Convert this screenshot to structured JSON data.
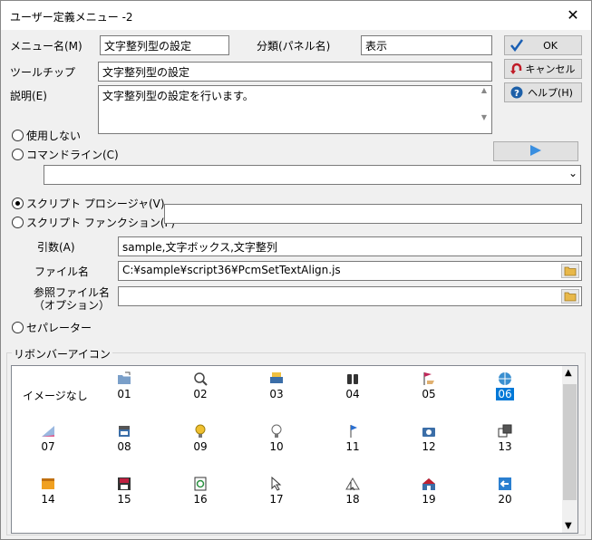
{
  "window": {
    "title": "ユーザー定義メニュー  -2",
    "close": "✕"
  },
  "form": {
    "menu_name_label": "メニュー名(M)",
    "menu_name_value": "文字整列型の設定",
    "category_label": "分類(パネル名)",
    "category_value": "表示",
    "tooltip_label": "ツールチップ",
    "tooltip_value": "文字整列型の設定",
    "description_label": "説明(E)",
    "description_value": "文字整列型の設定を行います。"
  },
  "buttons": {
    "ok": "OK",
    "cancel": "キャンセル",
    "help": "ヘルプ(H)"
  },
  "options": {
    "none": "使用しない",
    "command_line": "コマンドライン(C)",
    "script_procedure": "スクリプト プロシージャ(V)",
    "script_function": "スクリプト ファンクション(F)",
    "separator": "セパレーター",
    "selected": "script_procedure"
  },
  "script": {
    "args_label": "引数(A)",
    "args_value": "sample,文字ボックス,文字整列",
    "file_label": "ファイル名",
    "file_value": "C:¥sample¥script36¥PcmSetTextAlign.js",
    "ref_label_1": "参照ファイル名",
    "ref_label_2": "（オプション）",
    "ref_value": ""
  },
  "ribbon": {
    "group_label": "リボンバーアイコン",
    "no_image": "イメージなし",
    "icons": [
      {
        "num": "01",
        "icon": "folder-open-icon"
      },
      {
        "num": "02",
        "icon": "magnifier-icon"
      },
      {
        "num": "03",
        "icon": "printer-icon"
      },
      {
        "num": "04",
        "icon": "binoculars-icon"
      },
      {
        "num": "05",
        "icon": "flag-hand-icon"
      },
      {
        "num": "06",
        "icon": "globe-icon",
        "selected": true
      },
      {
        "num": "07",
        "icon": "gradient-icon"
      },
      {
        "num": "08",
        "icon": "printer-box-icon"
      },
      {
        "num": "09",
        "icon": "lightbulb-on-icon"
      },
      {
        "num": "10",
        "icon": "lightbulb-off-icon"
      },
      {
        "num": "11",
        "icon": "pin-flag-icon"
      },
      {
        "num": "12",
        "icon": "camera-icon"
      },
      {
        "num": "13",
        "icon": "copy-windows-icon"
      },
      {
        "num": "14",
        "icon": "window-icon"
      },
      {
        "num": "15",
        "icon": "floppy-icon"
      },
      {
        "num": "16",
        "icon": "refresh-page-icon"
      },
      {
        "num": "17",
        "icon": "cursor-icon"
      },
      {
        "num": "18",
        "icon": "move-cursor-icon"
      },
      {
        "num": "19",
        "icon": "home-icon"
      },
      {
        "num": "20",
        "icon": "back-arrow-icon"
      }
    ]
  }
}
